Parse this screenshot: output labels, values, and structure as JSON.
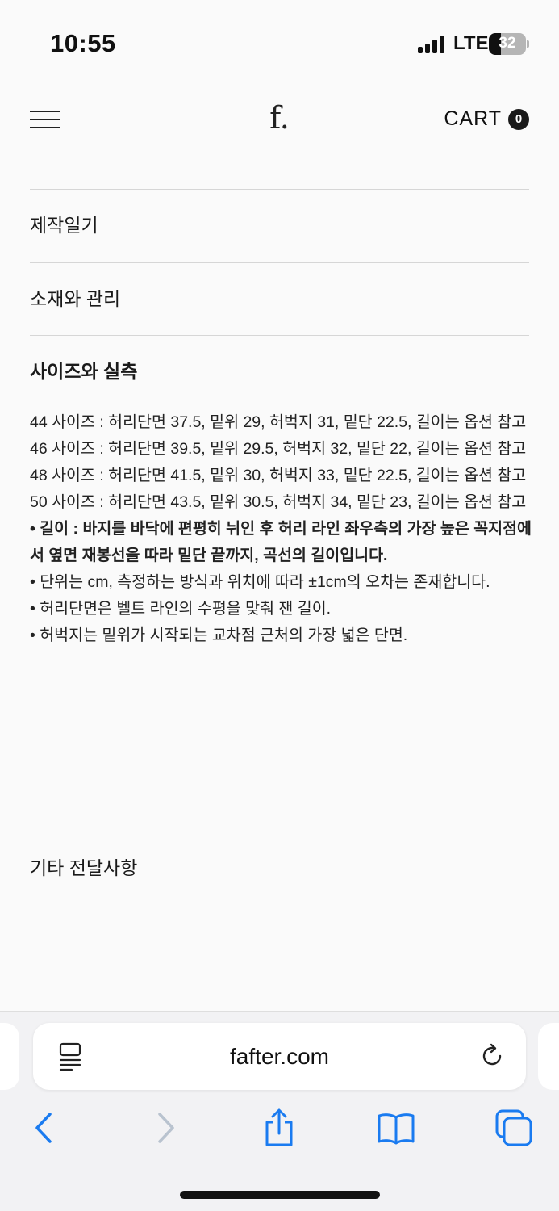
{
  "status": {
    "time": "10:55",
    "network": "LTE",
    "battery": "32",
    "battery_level": 0.32
  },
  "header": {
    "logo": "f.",
    "cart_label": "CART",
    "cart_count": "0"
  },
  "sections": [
    {
      "title": "제작일기"
    },
    {
      "title": "소재와 관리"
    },
    {
      "title": "사이즈와 실측"
    },
    {
      "title": "기타 전달사항"
    }
  ],
  "size_info": [
    "44 사이즈 : 허리단면 37.5, 밑위 29, 허벅지 31, 밑단 22.5, 길이는 옵션 참고",
    "46 사이즈 : 허리단면 39.5, 밑위 29.5, 허벅지 32, 밑단 22, 길이는 옵션 참고",
    "48 사이즈 : 허리단면 41.5, 밑위 30, 허벅지 33, 밑단 22.5, 길이는 옵션 참고",
    "50 사이즈 : 허리단면 43.5, 밑위 30.5, 허벅지 34, 밑단 23, 길이는 옵션 참고",
    "• 길이 : 바지를 바닥에 편평히 뉘인 후 허리 라인 좌우측의 가장 높은 꼭지점에서 옆면 재봉선을 따라 밑단 끝까지, 곡선의 길이입니다.",
    "• 단위는 cm, 측정하는 방식과 위치에 따라 ±1cm의 오차는 존재합니다.",
    "• 허리단면은 벨트 라인의 수평을 맞춰 잰 길이.",
    "• 허벅지는 밑위가 시작되는 교차점 근처의 가장 넓은 단면."
  ],
  "browser": {
    "url": "fafter.com"
  },
  "icons": {
    "menu": "hamburger-menu-icon",
    "reader": "reader-mode-icon",
    "reload": "reload-icon",
    "back": "back-chevron-icon",
    "forward": "forward-chevron-icon",
    "share": "share-icon",
    "bookmarks": "bookmarks-book-icon",
    "tabs": "tabs-icon"
  },
  "colors": {
    "accent": "#1a7bf0",
    "text": "#1a1a1a",
    "divider": "#d6d6d6"
  }
}
